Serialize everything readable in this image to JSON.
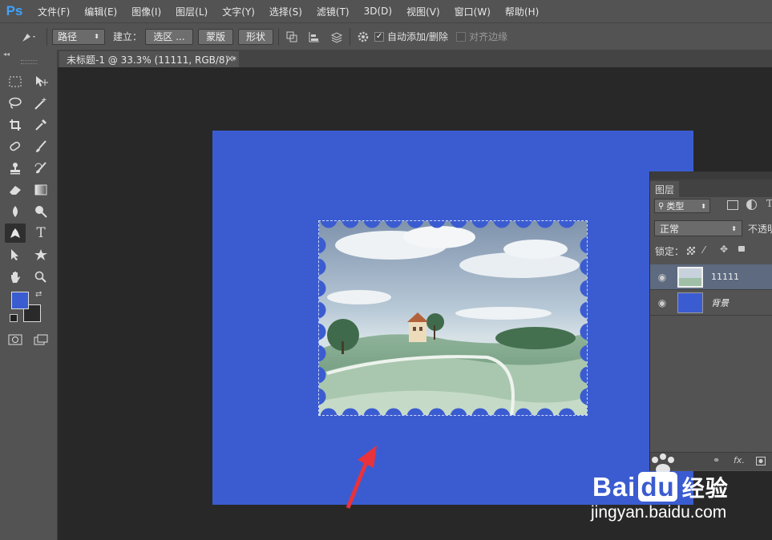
{
  "app": {
    "logo": "Ps"
  },
  "menu": [
    "文件(F)",
    "编辑(E)",
    "图像(I)",
    "图层(L)",
    "文字(Y)",
    "选择(S)",
    "滤镜(T)",
    "3D(D)",
    "视图(V)",
    "窗口(W)",
    "帮助(H)"
  ],
  "options": {
    "mode_select": "路径",
    "build_label": "建立：",
    "selection_btn": "选区 ...",
    "mask_btn": "蒙版",
    "shape_btn": "形状",
    "auto_add_delete": "自动添加/删除",
    "auto_add_checked": "✓",
    "align_edges": "对齐边缘"
  },
  "document": {
    "tab_title": "未标题-1 @ 33.3% (11111, RGB/8) *",
    "close": "×",
    "background_color": "#3b5cd0"
  },
  "tools": {
    "collapse": "◂◂"
  },
  "layers_panel": {
    "tab": "图层",
    "filter_select": "类型",
    "blend_mode": "正常",
    "opacity_label": "不透明",
    "lock_label": "锁定：",
    "layers": [
      {
        "name": "11111"
      },
      {
        "name": "背景"
      }
    ],
    "footer_fx": "fx."
  },
  "watermark": {
    "brand": "Bai",
    "brand2": "du",
    "suffix": "经验",
    "url": "jingyan.baidu.com"
  },
  "colors": {
    "accent": "#3b5cd0",
    "arrow": "#e8323c"
  }
}
